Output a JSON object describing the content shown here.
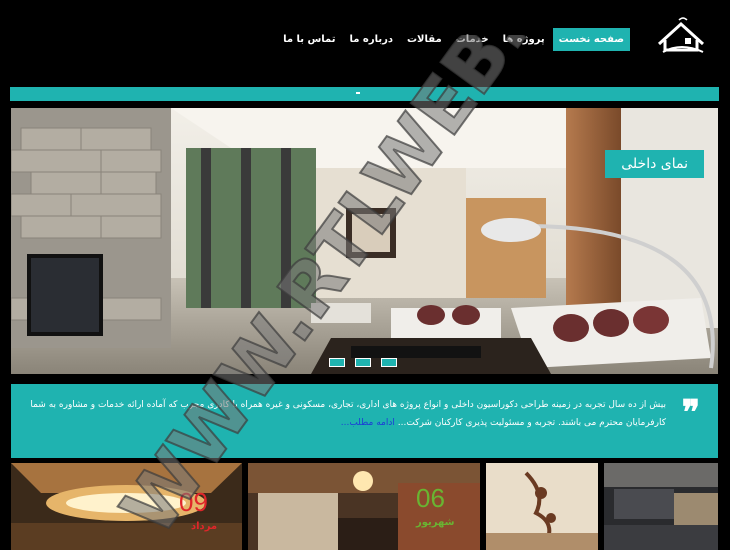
{
  "nav": {
    "items": [
      "صفحه نخست",
      "پروژه ها",
      "خدمات",
      "مقالات",
      "درباره ما",
      "تماس با ما"
    ],
    "active_index": 0
  },
  "slider": {
    "title": "نمای داخلی",
    "dots_count": 3
  },
  "about": {
    "text": "بیش از ده سال تجربه در زمینه طراحی دکوراسیون داخلی و انواع پروژه های اداری، تجاری، مسکونی و غیره همراه با کادری مجرب که آماده ارائه خدمات و مشاوره به شما کارفرمایان محترم می باشند. تجربه و مسئولیت پذیری کارکنان شرکت...",
    "link": "ادامه مطلب..."
  },
  "cards": [
    {
      "day": "09",
      "month": "مرداد",
      "color": "#e0262a"
    },
    {
      "day": "06",
      "month": "شهریور",
      "color": "#69b432"
    },
    {
      "day": "",
      "month": "",
      "color": ""
    },
    {
      "day": "",
      "month": "",
      "color": ""
    }
  ],
  "watermark": "WWW.RTLWEB.NET",
  "colors": {
    "accent": "#1fb3b0",
    "background": "#000000",
    "link": "#1d3bd6"
  }
}
